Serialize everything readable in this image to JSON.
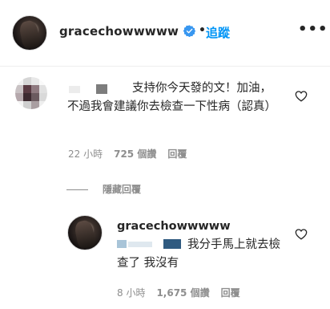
{
  "post": {
    "username": "gracechowwwww",
    "verified": true,
    "separator": "•",
    "follow_label": "追蹤",
    "more_label": "•••"
  },
  "comment": {
    "text": "支持你今天發的文！加油，不過我會建議你去檢查一下性病（認真）",
    "time": "22 小時",
    "likes": "725 個讚",
    "reply_label": "回覆"
  },
  "replies_toggle": "隱藏回覆",
  "reply": {
    "username": "gracechowwwww",
    "text": "我分手馬上就去檢查了 我沒有",
    "time": "8 小時",
    "likes": "1,675 個讚",
    "reply_label": "回覆"
  },
  "colors": {
    "link": "#0095f6",
    "verified": "#3897f0",
    "muted": "#8e8e8e",
    "text": "#262626"
  },
  "icons": {
    "like": "heart-outline-icon",
    "verified": "verified-badge-icon",
    "more": "more-dots-icon"
  }
}
